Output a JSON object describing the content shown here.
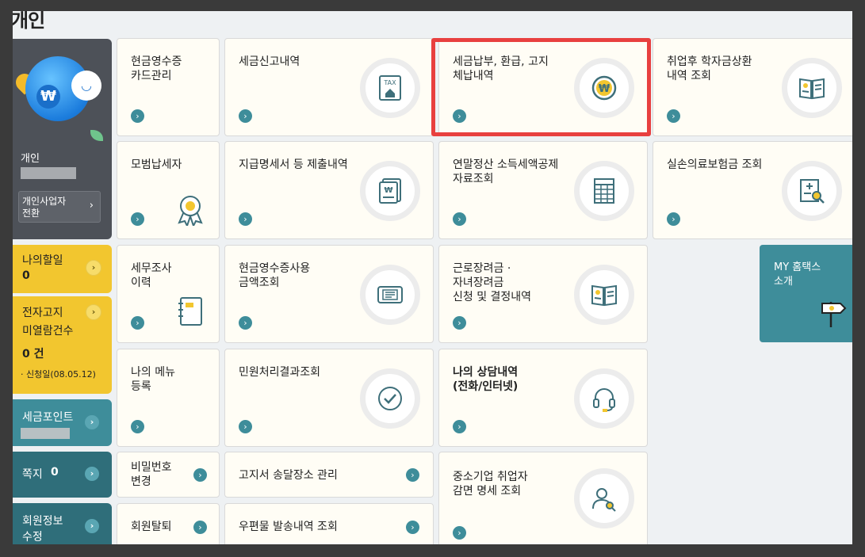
{
  "page_title": "개인",
  "profile": {
    "name": "개인",
    "switch_label_1": "개인사업자",
    "switch_label_2": "전환",
    "arrow": "›"
  },
  "sidebar": {
    "todo_label": "나의할일",
    "todo_count": "0",
    "notice_label_1": "전자고지",
    "notice_label_2": "미열람건수",
    "notice_count": "0 건",
    "notice_date": "· 신청일(08.05.12)",
    "points_label": "세금포인트",
    "message_label": "쪽지",
    "message_count": "0",
    "member_label_1": "회원정보",
    "member_label_2": "수정",
    "arrow": "›"
  },
  "tiles": {
    "t1": {
      "line1": "현금영수증",
      "line2": "카드관리"
    },
    "t2": {
      "line1": "세금신고내역",
      "icon_text": "TAX"
    },
    "t3": {
      "line1": "세금납부, 환급, 고지",
      "line2": "체납내역",
      "icon_text": "₩"
    },
    "t4": {
      "line1": "취업후 학자금상환",
      "line2": "내역 조회"
    },
    "t5": {
      "line1": "모범납세자"
    },
    "t6": {
      "line1": "지급명세서 등 제출내역",
      "icon_text": "₩"
    },
    "t7": {
      "line1": "연말정산 소득세액공제",
      "line2": "자료조회"
    },
    "t8": {
      "line1": "실손의료보험금 조회"
    },
    "t9": {
      "line1": "세무조사",
      "line2": "이력"
    },
    "t10": {
      "line1": "현금영수증사용",
      "line2": "금액조회"
    },
    "t11": {
      "line1": "근로장려금 ·",
      "line2": "자녀장려금",
      "line3": "신청 및 결정내역"
    },
    "t12": {
      "line1": "나의 메뉴",
      "line2": "등록"
    },
    "t13": {
      "line1": "민원처리결과조회"
    },
    "t14": {
      "line1": "나의 상담내역",
      "line2": "(전화/인터넷)"
    },
    "t15": {
      "line1": "비밀번호",
      "line2": "변경"
    },
    "t16": {
      "line1": "고지서 송달장소 관리"
    },
    "t17": {
      "line1": "중소기업 취업자",
      "line2": "감면 명세 조회"
    },
    "t18": {
      "line1": "회원탈퇴"
    },
    "t19": {
      "line1": "우편물 발송내역 조회"
    }
  },
  "mytax": {
    "line1": "MY 홈택스",
    "line2": "소개"
  },
  "arrow_glyph": "›",
  "colors": {
    "teal": "#3e8d9a",
    "yellow": "#f2c62f",
    "highlight": "#e8403f"
  }
}
